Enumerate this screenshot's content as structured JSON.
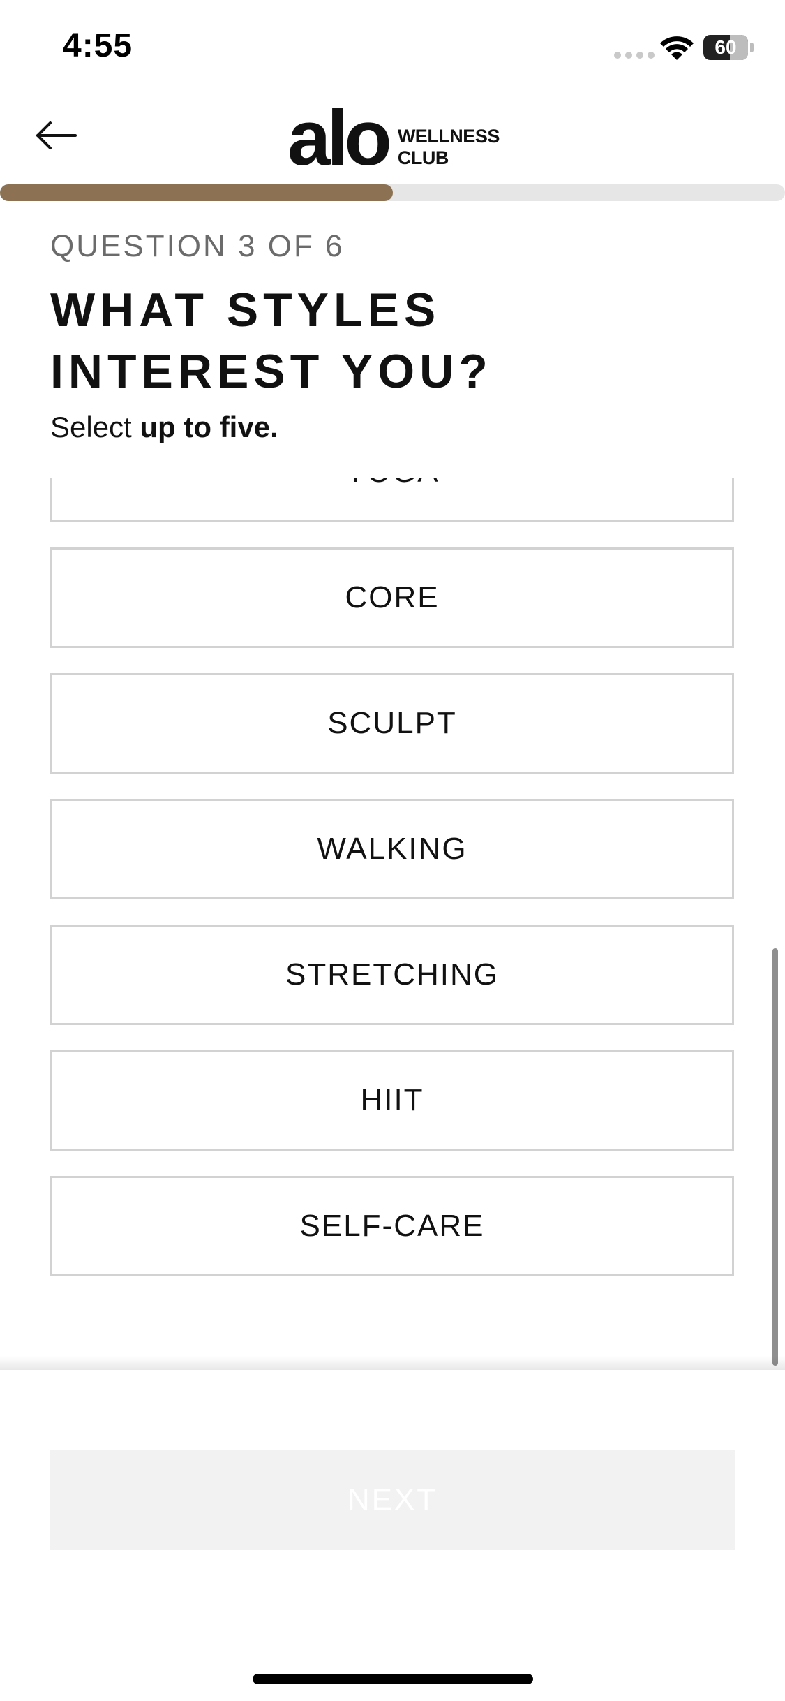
{
  "status_bar": {
    "time": "4:55",
    "battery_level": "60",
    "icons": [
      "signal-dots-icon",
      "wifi-icon",
      "battery-icon"
    ]
  },
  "header": {
    "back_icon": "arrow-left-icon",
    "logo_main": "alo",
    "logo_sub_line1": "WELLNESS",
    "logo_sub_line2": "CLUB"
  },
  "progress": {
    "current": 3,
    "total": 6,
    "fraction": 0.5,
    "fill_color": "#8c7152",
    "track_color": "#e6e6e6"
  },
  "question": {
    "counter": "QUESTION 3 OF 6",
    "title_line1": "WHAT STYLES",
    "title_line2": "INTEREST YOU?",
    "subtitle_prefix": "Select ",
    "subtitle_bold": "up to five."
  },
  "options": [
    {
      "label": "YOGA"
    },
    {
      "label": "CORE"
    },
    {
      "label": "SCULPT"
    },
    {
      "label": "WALKING"
    },
    {
      "label": "STRETCHING"
    },
    {
      "label": "HIIT"
    },
    {
      "label": "SELF-CARE"
    }
  ],
  "footer": {
    "next_label": "NEXT",
    "next_enabled": false
  }
}
